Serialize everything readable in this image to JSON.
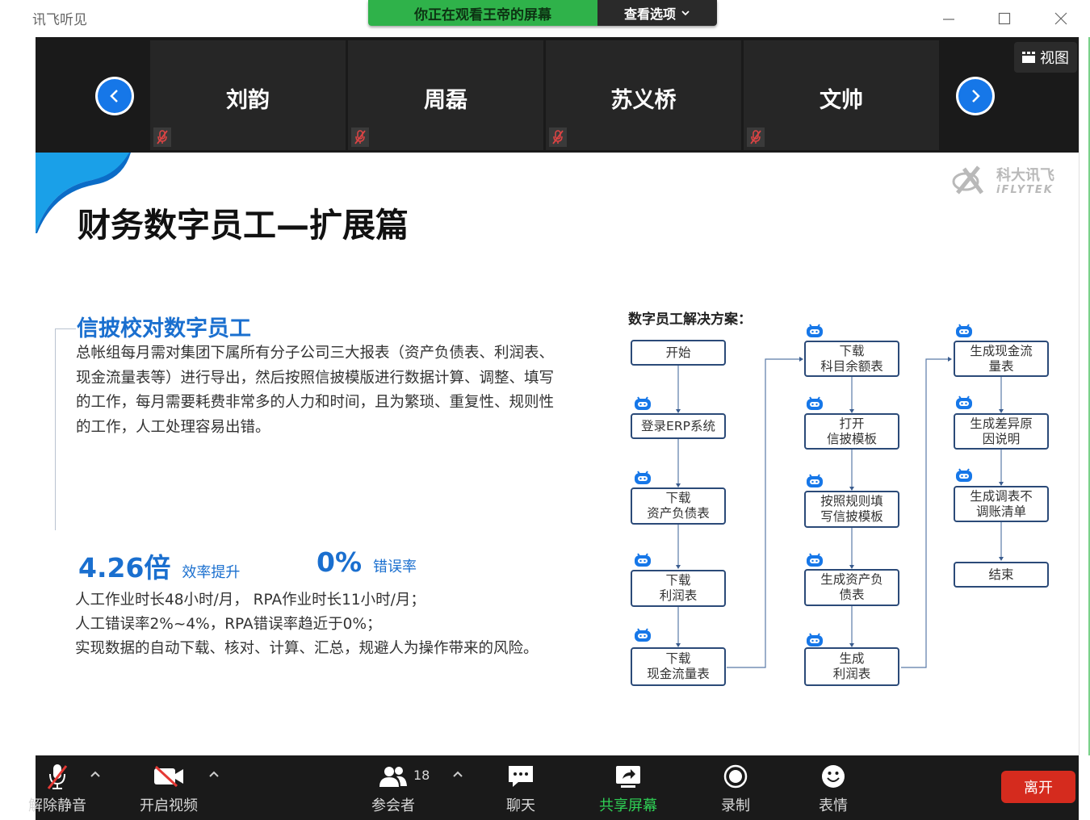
{
  "window": {
    "title": "讯飞听见",
    "share_banner": "你正在观看王帝的屏幕",
    "view_options": "查看选项"
  },
  "video_strip": {
    "participants": [
      {
        "name": "刘韵"
      },
      {
        "name": "周磊"
      },
      {
        "name": "苏义桥"
      },
      {
        "name": "文帅"
      }
    ],
    "view_label": "视图"
  },
  "slide": {
    "title": "财务数字员工—扩展篇",
    "logo_cn": "科大讯飞",
    "logo_en": "iFLYTEK",
    "section_title": "信披校对数字员工",
    "description": "总帐组每月需对集团下属所有分子公司三大报表（资产负债表、利润表、现金流量表等）进行导出，然后按照信披模版进行数据计算、调整、填写的工作，每月需要耗费非常多的人力和时间，且为繁琐、重复性、规则性的工作，人工处理容易出错。",
    "stats": [
      {
        "value": "4.26倍",
        "label": "效率提升"
      },
      {
        "value": "0%",
        "label": "错误率"
      }
    ],
    "details": [
      "人工作业时长48小时/月， RPA作业时长11小时/月；",
      "人工错误率2%~4%，RPA错误率趋近于0%；",
      "实现数据的自动下载、核对、计算、汇总，规避人为操作带来的风险。"
    ],
    "flow": {
      "heading": "数字员工解决方案：",
      "col1": [
        "开始",
        "登录ERP系统",
        "下载\n资产负债表",
        "下载\n利润表",
        "下载\n现金流量表"
      ],
      "col2": [
        "下载\n科目余额表",
        "打开\n信披模板",
        "按照规则填\n写信披模板",
        "生成资产负\n债表",
        "生成\n利润表"
      ],
      "col3": [
        "生成现金流\n量表",
        "生成差异原\n因说明",
        "生成调表不\n调账清单",
        "结束"
      ]
    }
  },
  "toolbar": {
    "mute": "解除静音",
    "video": "开启视频",
    "participants": "参会者",
    "participant_count": "18",
    "chat": "聊天",
    "share": "共享屏幕",
    "record": "录制",
    "reactions": "表情",
    "leave": "离开"
  },
  "colors": {
    "share_green": "#2fb24a",
    "accent_blue": "#1a6fcf",
    "leave_red": "#d52b1e"
  }
}
